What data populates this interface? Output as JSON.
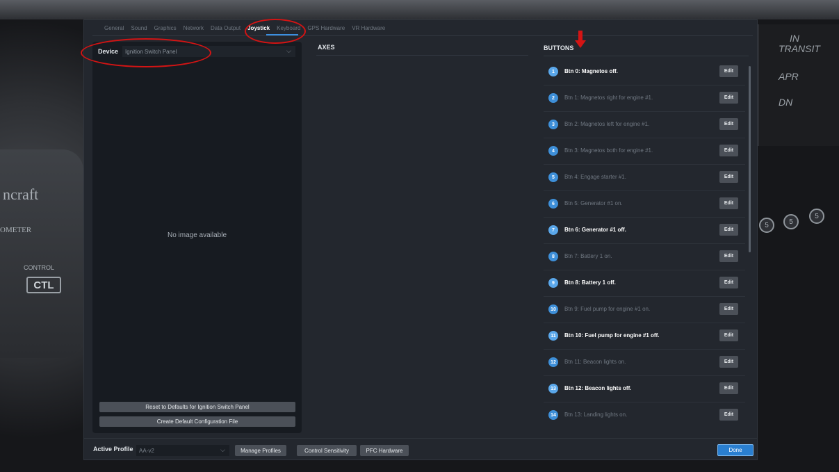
{
  "tabs": [
    {
      "label": "General"
    },
    {
      "label": "Sound"
    },
    {
      "label": "Graphics"
    },
    {
      "label": "Network"
    },
    {
      "label": "Data Output"
    },
    {
      "label": "Joystick",
      "active": true
    },
    {
      "label": "Keyboard"
    },
    {
      "label": "GPS Hardware"
    },
    {
      "label": "VR Hardware"
    }
  ],
  "device": {
    "label": "Device",
    "selected": "Ignition Switch Panel"
  },
  "preview": {
    "no_image_text": "No image available"
  },
  "left_actions": {
    "reset_label": "Reset to Defaults for Ignition Switch Panel",
    "create_label": "Create Default Configuration File"
  },
  "axes": {
    "title": "AXES"
  },
  "buttons": {
    "title": "BUTTONS",
    "edit_label": "Edit",
    "items": [
      {
        "num": "1",
        "text": "Btn 0: Magnetos off.",
        "bright": true
      },
      {
        "num": "2",
        "text": "Btn 1: Magnetos right for engine #1.",
        "bright": false
      },
      {
        "num": "3",
        "text": "Btn 2: Magnetos left for engine #1.",
        "bright": false
      },
      {
        "num": "4",
        "text": "Btn 3: Magnetos both for engine #1.",
        "bright": false
      },
      {
        "num": "5",
        "text": "Btn 4: Engage starter #1.",
        "bright": false
      },
      {
        "num": "6",
        "text": "Btn 5: Generator #1 on.",
        "bright": false
      },
      {
        "num": "7",
        "text": "Btn 6: Generator #1 off.",
        "bright": true
      },
      {
        "num": "8",
        "text": "Btn 7: Battery 1 on.",
        "bright": false
      },
      {
        "num": "9",
        "text": "Btn 8: Battery 1 off.",
        "bright": true
      },
      {
        "num": "10",
        "text": "Btn 9: Fuel pump for engine #1 on.",
        "bright": false
      },
      {
        "num": "11",
        "text": "Btn 10: Fuel pump for engine #1 off.",
        "bright": true
      },
      {
        "num": "12",
        "text": "Btn 11: Beacon lights on.",
        "bright": false
      },
      {
        "num": "13",
        "text": "Btn 12: Beacon lights off.",
        "bright": true
      },
      {
        "num": "14",
        "text": "Btn 13: Landing lights on.",
        "bright": false
      }
    ]
  },
  "footer": {
    "active_profile_label": "Active Profile",
    "profile_selected": "AA-v2",
    "manage_profiles_label": "Manage Profiles",
    "control_sensitivity_label": "Control Sensitivity",
    "pfc_hardware_label": "PFC Hardware",
    "done_label": "Done"
  },
  "cockpit": {
    "brand_text": "ncraft",
    "meter_text": "OMETER",
    "control_text": "CONTROL",
    "ctl_text": "CTL",
    "panel_in": "IN",
    "panel_transit": "TRANSIT",
    "panel_apr": "APR",
    "panel_dn": "DN",
    "knob_label": "5"
  },
  "colors": {
    "accent": "#3b8fe0",
    "annotation": "#d41414"
  }
}
